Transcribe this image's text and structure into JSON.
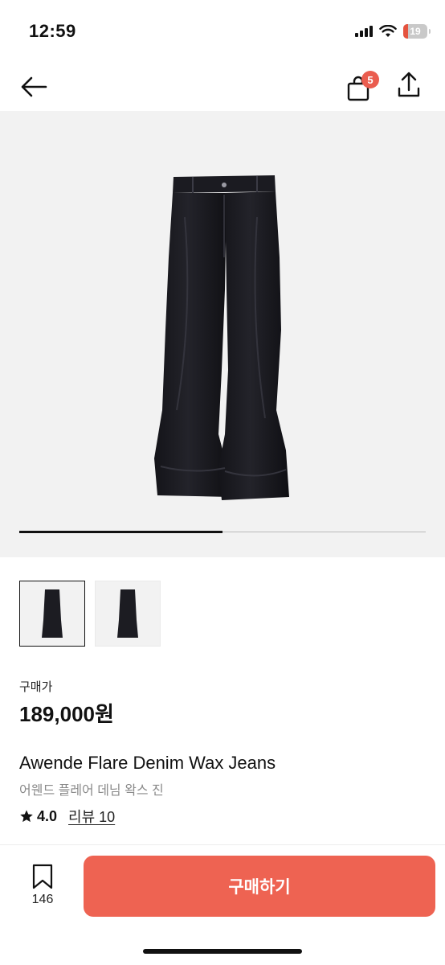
{
  "status_bar": {
    "time": "12:59",
    "battery_level": "19",
    "battery_level_fraction": 0.19,
    "battery_color": "#e5533f",
    "signal_icon": "cellular-signal-icon",
    "wifi_icon": "wifi-icon"
  },
  "nav": {
    "back_icon": "arrow-left-icon",
    "cart_icon": "shopping-bag-icon",
    "cart_badge_count": "5",
    "share_icon": "share-upload-icon"
  },
  "gallery": {
    "image_description_icon": "jeans-product-photo",
    "slider_progress_fraction": 0.5,
    "thumbnails": [
      {
        "selected": true
      },
      {
        "selected": false
      }
    ]
  },
  "product": {
    "price_label": "구매가",
    "price": "189,000원",
    "name": "Awende Flare Denim Wax Jeans",
    "name_korean": "어웬드 플레어 데님 왁스 진",
    "rating_icon": "star-icon",
    "rating": "4.0",
    "review_link": "리뷰 10"
  },
  "bottom_bar": {
    "bookmark_icon": "bookmark-icon",
    "bookmark_count": "146",
    "buy_label": "구매하기",
    "accent_color": "#ee6352"
  }
}
